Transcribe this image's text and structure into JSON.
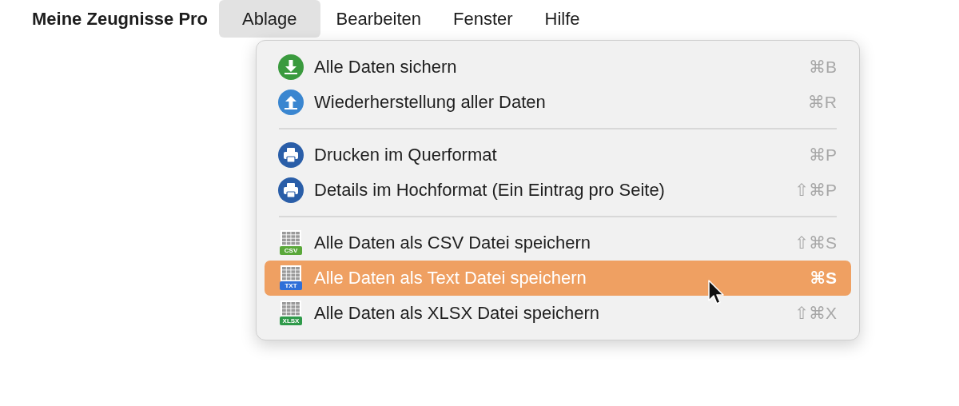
{
  "menu_bar": {
    "app_name": "Meine Zeugnisse Pro",
    "menus": [
      {
        "label": "Ablage",
        "selected": true
      },
      {
        "label": "Bearbeiten",
        "selected": false
      },
      {
        "label": "Fenster",
        "selected": false
      },
      {
        "label": "Hilfe",
        "selected": false
      }
    ]
  },
  "dropdown": {
    "items": [
      {
        "kind": "download",
        "label": "Alle Daten sichern",
        "shortcut": "⌘B",
        "selected": false
      },
      {
        "kind": "upload",
        "label": "Wiederherstellung aller Daten",
        "shortcut": "⌘R",
        "selected": false
      },
      {
        "kind": "separator"
      },
      {
        "kind": "print",
        "label": "Drucken im Querformat",
        "shortcut": "⌘P",
        "selected": false
      },
      {
        "kind": "print",
        "label": "Details im Hochformat (Ein Eintrag pro Seite)",
        "shortcut": "⇧⌘P",
        "selected": false
      },
      {
        "kind": "separator"
      },
      {
        "kind": "file",
        "badge": "CSV",
        "color": "#5aa83a",
        "label": "Alle Daten als CSV Datei speichern",
        "shortcut": "⇧⌘S",
        "selected": false
      },
      {
        "kind": "file",
        "badge": "TXT",
        "color": "#2f6fd8",
        "label": "Alle Daten als Text Datei speichern",
        "shortcut": "⌘S",
        "selected": true
      },
      {
        "kind": "file",
        "badge": "XLSX",
        "color": "#2f9a4a",
        "label": "Alle Daten als XLSX Datei speichern",
        "shortcut": "⇧⌘X",
        "selected": false
      }
    ]
  }
}
